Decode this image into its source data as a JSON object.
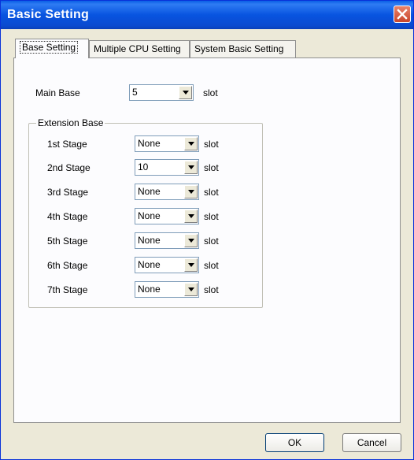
{
  "window": {
    "title": "Basic Setting"
  },
  "tabs": [
    {
      "label": "Base Setting"
    },
    {
      "label": "Multiple CPU Setting"
    },
    {
      "label": "System Basic Setting"
    }
  ],
  "main_base": {
    "label": "Main Base",
    "value": "5",
    "unit": "slot"
  },
  "extension": {
    "legend": "Extension Base",
    "stages": [
      {
        "label": "1st Stage",
        "value": "None",
        "unit": "slot"
      },
      {
        "label": "2nd Stage",
        "value": "10",
        "unit": "slot"
      },
      {
        "label": "3rd Stage",
        "value": "None",
        "unit": "slot"
      },
      {
        "label": "4th Stage",
        "value": "None",
        "unit": "slot"
      },
      {
        "label": "5th Stage",
        "value": "None",
        "unit": "slot"
      },
      {
        "label": "6th Stage",
        "value": "None",
        "unit": "slot"
      },
      {
        "label": "7th Stage",
        "value": "None",
        "unit": "slot"
      }
    ]
  },
  "buttons": {
    "ok": "OK",
    "cancel": "Cancel"
  },
  "icons": {
    "close": "close-icon",
    "dropdown": "chevron-down-icon"
  }
}
